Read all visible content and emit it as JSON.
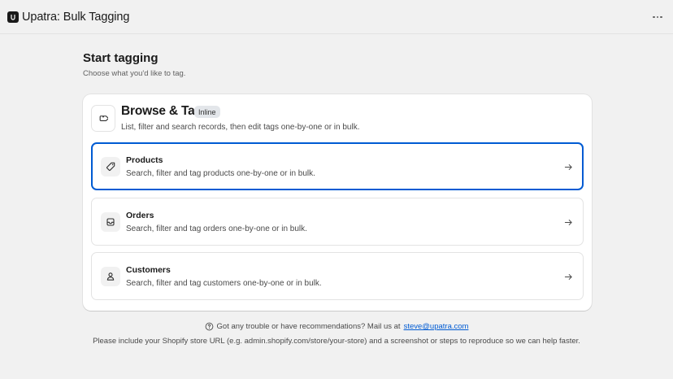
{
  "app": {
    "title": "Upatra: Bulk Tagging",
    "logo_icon": "upatra-logo",
    "more_icon": "ellipsis-icon"
  },
  "page": {
    "title": "Start tagging",
    "subtitle": "Choose what you'd like to tag."
  },
  "card": {
    "title": "Browse & Tag",
    "badge": "Inline",
    "description": "List, filter and search records, then edit tags one-by-one or in bulk.",
    "icon": "tag-icon",
    "options": [
      {
        "title": "Products",
        "description": "Search, filter and tag products one-by-one or in bulk.",
        "icon": "tag-icon",
        "selected": true
      },
      {
        "title": "Orders",
        "description": "Search, filter and tag orders one-by-one or in bulk.",
        "icon": "inbox-icon",
        "selected": false
      },
      {
        "title": "Customers",
        "description": "Search, filter and tag customers one-by-one or in bulk.",
        "icon": "person-icon",
        "selected": false
      }
    ]
  },
  "footer": {
    "help_text": "Got any trouble or have recommendations? Mail us at",
    "email": "steve@upatra.com",
    "note": "Please include your Shopify store URL (e.g. admin.shopify.com/store/your-store) and a screenshot or steps to reproduce so we can help faster."
  },
  "colors": {
    "background": "#f1f1f1",
    "card": "#ffffff",
    "accent": "#005bd3",
    "badge": "#e3e6ea",
    "text": "#303030"
  }
}
